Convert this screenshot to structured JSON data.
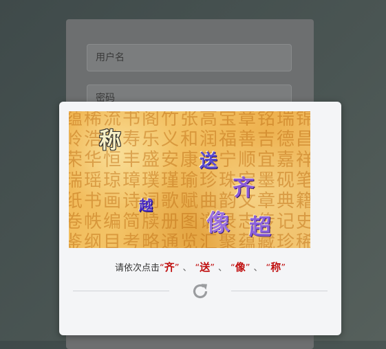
{
  "login": {
    "username_placeholder": "用户名",
    "password_placeholder": "密码"
  },
  "captcha": {
    "image_characters": [
      "称",
      "送",
      "齐",
      "越",
      "像",
      "超"
    ],
    "background_text": "蕴稀流书阁竹张高宝章铭瑞锦岭浩蕊寿乐义和润福善吉德昌荣华恒丰盛安康泰宁顺宜嘉祥瑞瑶琼璋璞瑾瑜珍珠宝墨砚笔纸书画诗词歌赋曲韵文章典籍卷帙编简牍册图谱录志传记史鉴纲目考略通览汇聚蕴藏珍稀流芳百世张高铭章",
    "instruction_prefix": "请依次点击",
    "targets": [
      "齐",
      "送",
      "像",
      "称"
    ],
    "separator": "、",
    "refresh_icon": "refresh-icon"
  }
}
